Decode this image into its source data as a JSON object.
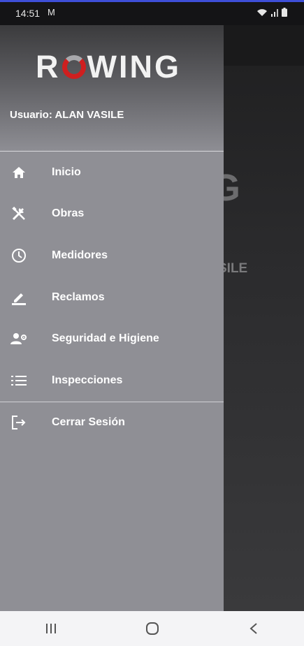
{
  "status": {
    "time": "14:51",
    "mail_glyph": "M"
  },
  "background": {
    "partial_text_1": "G",
    "partial_text_2": "SILE"
  },
  "drawer": {
    "logo": {
      "left": "R",
      "right": "WING"
    },
    "user_label": "Usuario: ALAN  VASILE",
    "items": [
      {
        "label": "Inicio",
        "icon": "home-icon"
      },
      {
        "label": "Obras",
        "icon": "tools-icon"
      },
      {
        "label": "Medidores",
        "icon": "clock-icon"
      },
      {
        "label": "Reclamos",
        "icon": "pencil-icon"
      },
      {
        "label": "Seguridad e Higiene",
        "icon": "person-gear-icon"
      },
      {
        "label": "Inspecciones",
        "icon": "list-icon"
      }
    ],
    "logout": {
      "label": "Cerrar Sesión",
      "icon": "logout-icon"
    }
  },
  "colors": {
    "accent_ring": "#cf1f1f",
    "drawer_bg": "#8f8f95",
    "top_line": "#3e4fd8"
  }
}
